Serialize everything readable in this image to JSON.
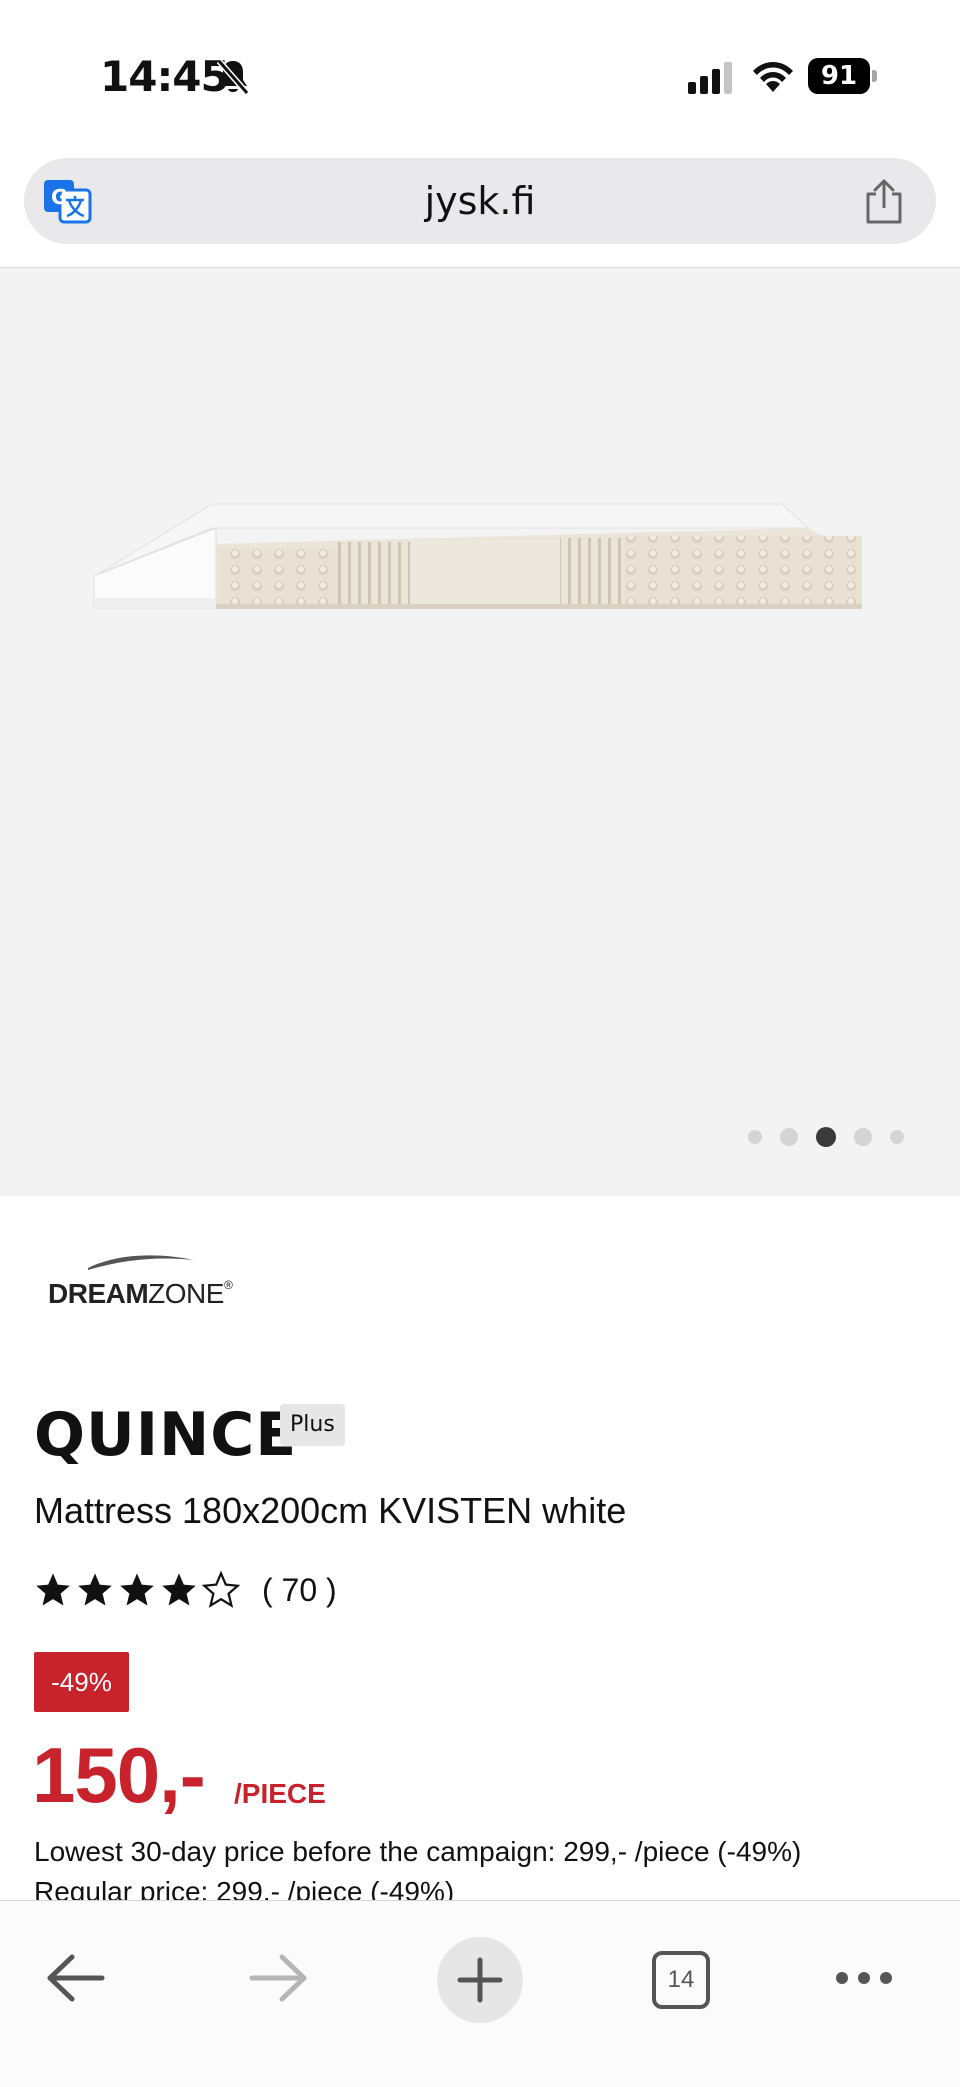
{
  "status_bar": {
    "time": "14:45",
    "battery": "91"
  },
  "address_bar": {
    "url": "jysk.fi"
  },
  "gallery": {
    "image_count": 5,
    "active_index": 2
  },
  "product": {
    "brand_logo_text_bold": "DREAM",
    "brand_logo_text_regular": "ZONE",
    "name": "QUINCE",
    "badge": "Plus",
    "description": "Mattress 180x200cm KVISTEN white",
    "rating": 4,
    "rating_max": 5,
    "review_count": "( 70 )",
    "discount": "-49%",
    "price": "150,-",
    "price_unit": "/PIECE",
    "lowest_price_text": "Lowest 30-day price before the campaign: 299,- /piece (-49%)",
    "regular_price_text": "Regular price: 299,- /piece (-49%)"
  },
  "toolbar": {
    "tab_count": "14"
  },
  "colors": {
    "accent_red": "#c8222d",
    "gallery_bg": "#f3f3f3",
    "address_bar_bg": "#e9e9eb"
  }
}
